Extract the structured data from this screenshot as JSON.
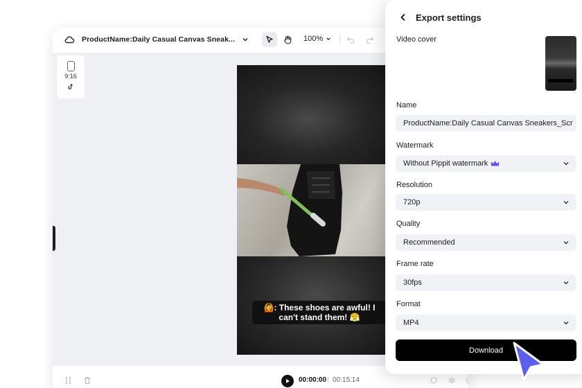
{
  "editor": {
    "project_title": "ProductName:Daily Casual Canvas Sneak...",
    "zoom": "100%",
    "aspect_ratio": "9:16",
    "caption": "🙆: These shoes are awful! I can't stand them! 😤",
    "time_current": "00:00:00",
    "time_separator": "|",
    "time_total": "00:15:14"
  },
  "export": {
    "title": "Export settings",
    "video_cover_label": "Video cover",
    "name_label": "Name",
    "name_value": "ProductName:Daily Casual Canvas Sneakers_Scr",
    "watermark_label": "Watermark",
    "watermark_value": "Without Pippit watermark",
    "resolution_label": "Resolution",
    "resolution_value": "720p",
    "quality_label": "Quality",
    "quality_value": "Recommended",
    "frame_rate_label": "Frame rate",
    "frame_rate_value": "30fps",
    "format_label": "Format",
    "format_value": "MP4",
    "download_label": "Download"
  },
  "colors": {
    "accent_cursor": "#5b5ff0",
    "crown": "#6d4cf5",
    "download_bg": "#000000"
  }
}
